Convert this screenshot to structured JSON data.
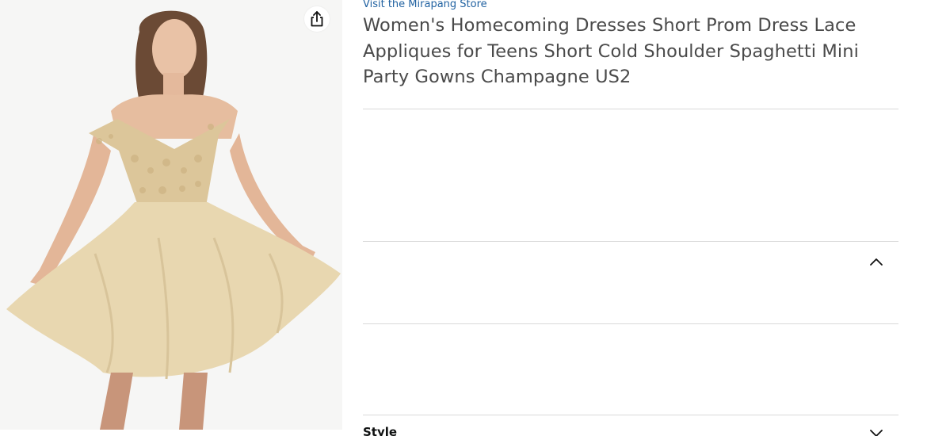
{
  "store": {
    "link_text": "Visit the Mirapang Store"
  },
  "product": {
    "title": "Women's Homecoming Dresses Short Prom Dress Lace Appliques for Teens Short Cold Shoulder Spaghetti Mini Party Gowns Champagne US2",
    "image_icon": "product-photo",
    "dress_color": "#e8d7b0"
  },
  "actions": {
    "share_icon": "share-icon"
  },
  "sections": {
    "collapsible": {
      "state": "expanded",
      "chevron_icon": "chevron-up-icon"
    },
    "style": {
      "label": "Style",
      "state": "collapsed",
      "chevron_icon": "chevron-down-icon"
    }
  },
  "colors": {
    "link": "#2162a1",
    "title_text": "#4a4a4a",
    "divider": "#d9d9d9"
  }
}
